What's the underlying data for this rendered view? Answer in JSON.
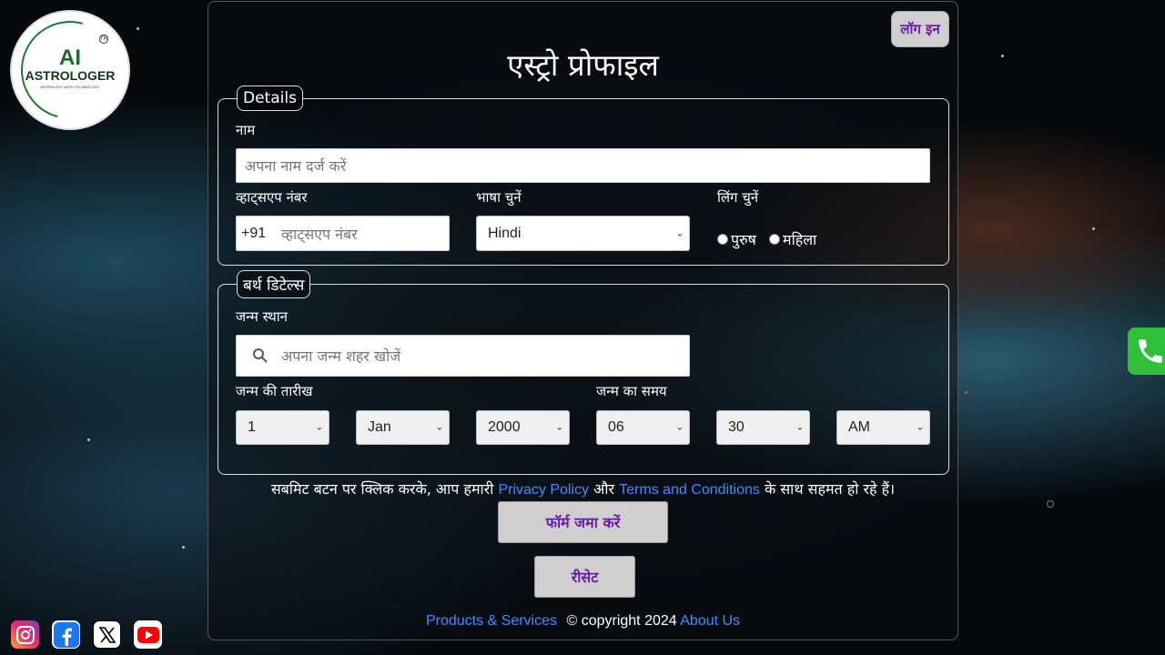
{
  "logo": {
    "line1": "AI",
    "line2": "ASTROLOGER",
    "tagline": "ASTROLOGY WITH TECHNOLOGY",
    "tm": "TM"
  },
  "header": {
    "login_label": "लॉग इन",
    "title": "एस्ट्रो प्रोफाइल"
  },
  "details": {
    "legend": "Details",
    "name_label": "नाम",
    "name_placeholder": "अपना नाम दर्ज करें",
    "whatsapp_label": "व्हाट्सएप नंबर",
    "country_code": "+91",
    "whatsapp_placeholder": "व्हाट्सएप नंबर",
    "language_label": "भाषा चुनें",
    "language_value": "Hindi",
    "gender_label": "लिंग चुनें",
    "gender_male": "पुरुष",
    "gender_female": "महिला"
  },
  "birth": {
    "legend": "बर्थ डिटेल्स",
    "place_label": "जन्म स्थान",
    "place_placeholder": "अपना जन्म शहर खोजें",
    "date_label": "जन्म की तारीख",
    "time_label": "जन्म का समय",
    "day": "1",
    "month": "Jan",
    "year": "2000",
    "hour": "06",
    "minute": "30",
    "ampm": "AM"
  },
  "consent": {
    "prefix": "सबमिट बटन पर क्लिक करके, आप हमारी",
    "privacy": "Privacy Policy",
    "and": "और",
    "terms": "Terms and Conditions",
    "suffix": "के साथ सहमत हो रहे हैं।"
  },
  "actions": {
    "submit": "फॉर्म जमा करें",
    "reset": "रीसेट"
  },
  "footer": {
    "products": "Products & Services",
    "copyright": "© copyright 2024",
    "about": "About Us"
  },
  "colors": {
    "accent_text": "#6a1aa8",
    "link": "#3f8cff",
    "phone_bg": "#2fbf3a"
  }
}
